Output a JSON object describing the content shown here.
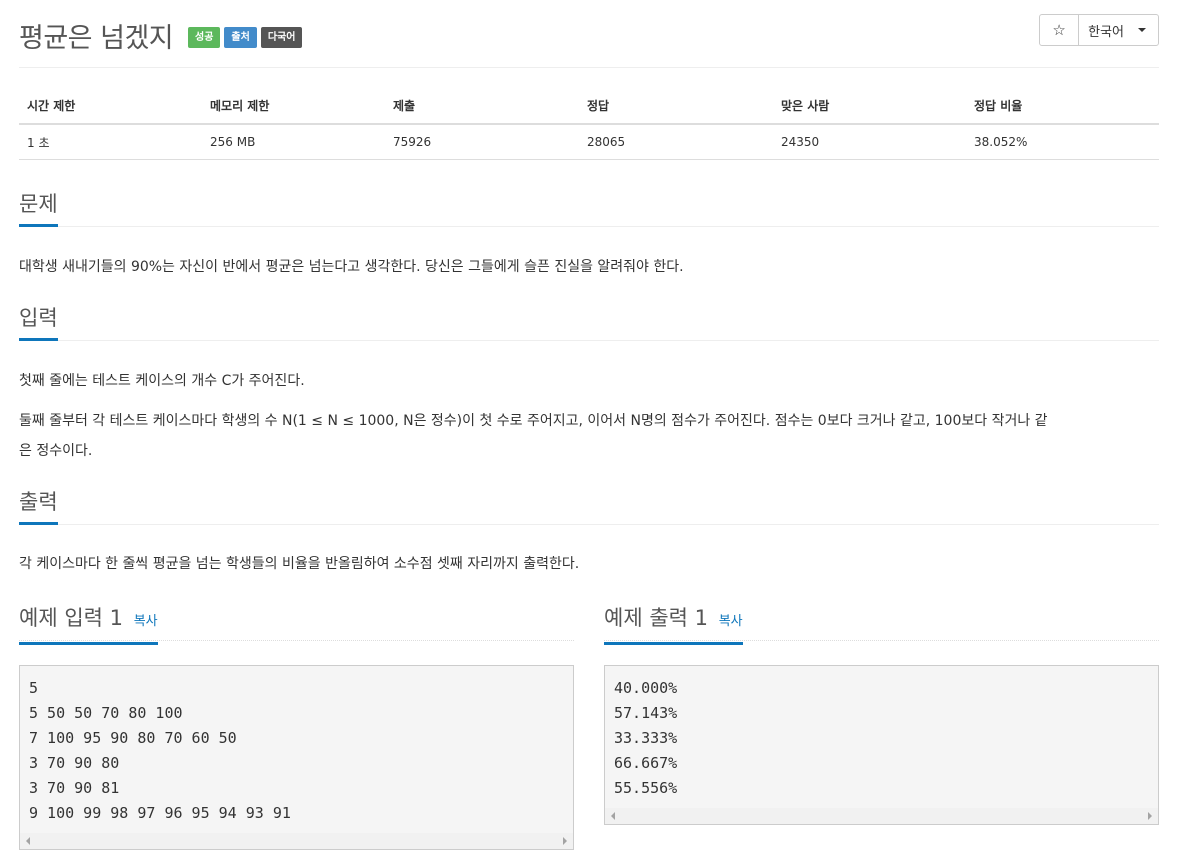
{
  "problem": {
    "title": "평균은 넘겠지",
    "labels": {
      "success": "성공",
      "source": "출처",
      "multilang": "다국어"
    }
  },
  "toolbar": {
    "star_icon": "☆",
    "language": "한국어"
  },
  "info_table": {
    "headers": [
      "시간 제한",
      "메모리 제한",
      "제출",
      "정답",
      "맞은 사람",
      "정답 비율"
    ],
    "values": [
      "1 초",
      "256 MB",
      "75926",
      "28065",
      "24350",
      "38.052%"
    ]
  },
  "sections": {
    "description": {
      "heading": "문제",
      "text": "대학생 새내기들의 90%는 자신이 반에서 평균은 넘는다고 생각한다. 당신은 그들에게 슬픈 진실을 알려줘야 한다."
    },
    "input": {
      "heading": "입력",
      "text1": "첫째 줄에는 테스트 케이스의 개수 C가 주어진다.",
      "text2_line1": "둘째 줄부터 각 테스트 케이스마다 학생의 수 N(1 ≤ N ≤ 1000, N은 정수)이 첫 수로 주어지고, 이어서 N명의 점수가 주어진다. 점수는 0보다 크거나 같고, 100보다 작거나 같",
      "text2_line2": "은 정수이다."
    },
    "output": {
      "heading": "출력",
      "text": "각 케이스마다 한 줄씩 평균을 넘는 학생들의 비율을 반올림하여 소수점 셋째 자리까지 출력한다."
    }
  },
  "samples": {
    "input": {
      "heading": "예제 입력 1",
      "copy_label": "복사",
      "lines": [
        "5",
        "5 50 50 70 80 100",
        "7 100 95 90 80 70 60 50",
        "3 70 90 80",
        "3 70 90 81",
        "9 100 99 98 97 96 95 94 93 91"
      ]
    },
    "output": {
      "heading": "예제 출력 1",
      "copy_label": "복사",
      "lines": [
        "40.000%",
        "57.143%",
        "33.333%",
        "66.667%",
        "55.556%"
      ]
    }
  },
  "colors": {
    "accent": "#0e76bb",
    "success": "#5cb85c",
    "primary": "#428bca",
    "default": "#555555"
  }
}
